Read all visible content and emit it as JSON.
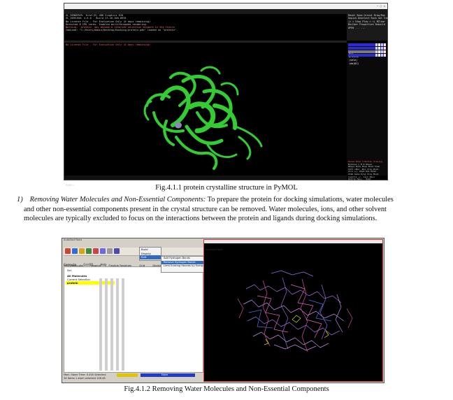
{
  "figure1": {
    "window_title": "PyMOL",
    "menu": [
      "File",
      "Edit",
      "Build",
      "Movie",
      "Display",
      "Setting",
      "Scene",
      "Mouse",
      "Wizard",
      "Plugin",
      "Help"
    ],
    "console_lines": [
      "GL_RENDERER: Intel(R) UHD Graphics 620",
      "GL_VERSION:  4.6.0 - Build 27.20.100.8935",
      "No License File - For Evaluation Only (0 days remaining)",
      " Detected 8 CPU cores.  Enabled multithreaded rendering.",
      "Warning: 'protein' may become a reserved selection keyword in the future",
      " CmdLoad: \"C:/Users/Admin/Desktop/Docking/protein.pdb\" loaded as \"protein\"."
    ],
    "viewport_message": "No License File - For Evaluation Only (0 days remaining)",
    "right_controls": [
      "Reset  Zoom  Orient  Draw/Ray",
      "Unpick  Deselect  Rock  Get View",
      "|<   <   Stop  Play  >  >|  MClear",
      "Builder  Properties  Rebuild",
      "                 OPEN   ...   ..."
    ],
    "objects": [
      {
        "name": "all",
        "color": "#2d2dcf"
      },
      {
        "name": "protein",
        "color": "#2d2dcf"
      },
      {
        "name": "(sele)",
        "color": "#7a7a7a"
      },
      {
        "name": "(obj01)",
        "color": "#2d2dcf"
      }
    ],
    "mouse_help": [
      "Mouse Mode 3-Button Viewing",
      "Buttons  L    M    R  Wheel",
      " &Keys  Rota Move MovZ Slab",
      " Shft  +Box -Box Clip MovS",
      " Ctrl  +/-  PkAt Pk1  MvSZ",
      " CtSh  Sele Orig Clip MovZ",
      "SnglClk +/-  Cent Menu",
      "DblClk  Menu  -  PkAt"
    ],
    "status_line": "PyMOL>",
    "caption": "Fig.4.1.1 protein crystalline structure in PyMOL",
    "accent_color": "#33cc33"
  },
  "paragraph": {
    "number": "1)",
    "lead": "Removing Water Molecules and Non-Essential Components:",
    "lines": [
      " To prepare the protein for docking simulations, water molecules",
      "and other non-essential components present in the crystal structure can be removed. Water molecules, ions, and other solvent",
      "molecules are typically excluded to focus on the interactions between the protein and ligands during docking simulations."
    ]
  },
  "figure2": {
    "menu": [
      "File",
      "3D Graphics",
      "Edit",
      "Select",
      "Display",
      "Color",
      "Hydrogen Bonds",
      "Compute",
      "Grid3D",
      "Help"
    ],
    "tabs": [
      "PMV Molecules",
      "Legend",
      "Flexible Residues",
      "Grid",
      "Docking",
      "Run"
    ],
    "subtabs": [
      "Dashboard",
      "Scenario",
      "Tools"
    ],
    "dashboard_header": "Sel.",
    "dashboard_rows": [
      "All Molecules",
      "Current Selection",
      "protein"
    ],
    "dropdown_items": [
      "Build",
      "Display",
      "Edit"
    ],
    "submenu_items": [
      "Add Hydrogen Bonds",
      "Remove Hydrogen Bonds",
      "Limit Existing Hbonds by Energy"
    ],
    "viewer_title": "AutoDockTools",
    "status": [
      "Mod.: None        Time: 0.000  Selected:",
      "  26 items       1 atom selected  148.48"
    ],
    "mode_label": "None",
    "caption": "Fig.4.1.2 Removing Water Molecules and Non-Essential Components"
  }
}
